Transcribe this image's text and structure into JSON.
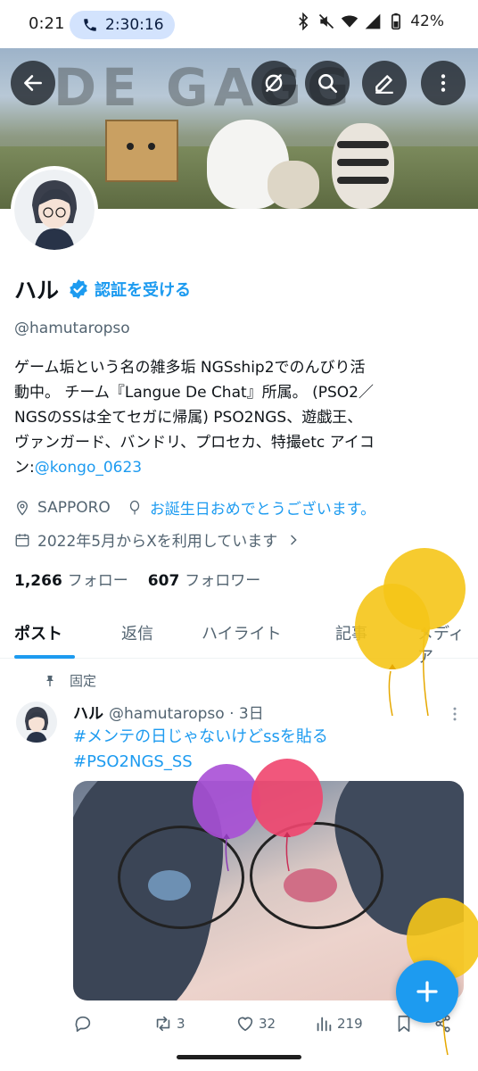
{
  "status_bar": {
    "time": "0:21",
    "call_timer": "2:30:16",
    "battery": "42%"
  },
  "profile": {
    "name": "ハル",
    "get_verified": "認証を受ける",
    "handle": "@hamutaropso",
    "bio_lines": [
      "ゲーム垢という名の雑多垢 NGSship2でのんびり活",
      "動中。 チーム『Langue De Chat』所属。 (PSO2／",
      "NGSのSSは全てセガに帰属) PSO2NGS、遊戯王、",
      "ヴァンガード、バンドリ、プロセカ、特撮etc アイコ"
    ],
    "bio_last_prefix": "ン:",
    "bio_link": "@kongo_0623",
    "location": "SAPPORO",
    "birthday": "お誕生日おめでとうございます。",
    "joined": "2022年5月からXを利用しています",
    "following_count": "1,266",
    "following_label": "フォロー",
    "followers_count": "607",
    "followers_label": "フォロワー"
  },
  "tabs": [
    "ポスト",
    "返信",
    "ハイライト",
    "記事",
    "メディア"
  ],
  "pinned_label": "固定",
  "post": {
    "author": "ハル",
    "handle_time": "@hamutaropso · 3日",
    "hashtags": [
      "#メンテの日じゃないけどssを貼る",
      "#PSO2NGS_SS"
    ],
    "retweets": "3",
    "likes": "32",
    "views": "219"
  },
  "colors": {
    "accent": "#1d9bf0",
    "text": "#0f1419",
    "muted": "#536471",
    "balloon_yellow": "#f5c518",
    "balloon_purple": "#a84fd6",
    "balloon_red": "#f0456e"
  },
  "icons": [
    "back-arrow-icon",
    "grok-icon",
    "search-icon",
    "pen-icon",
    "more-vertical-icon",
    "verified-badge-icon",
    "location-icon",
    "balloon-icon",
    "calendar-icon",
    "chevron-right-icon",
    "pin-icon",
    "reply-icon",
    "retweet-icon",
    "like-icon",
    "views-icon",
    "bookmark-icon",
    "share-icon",
    "compose-plus-icon"
  ]
}
